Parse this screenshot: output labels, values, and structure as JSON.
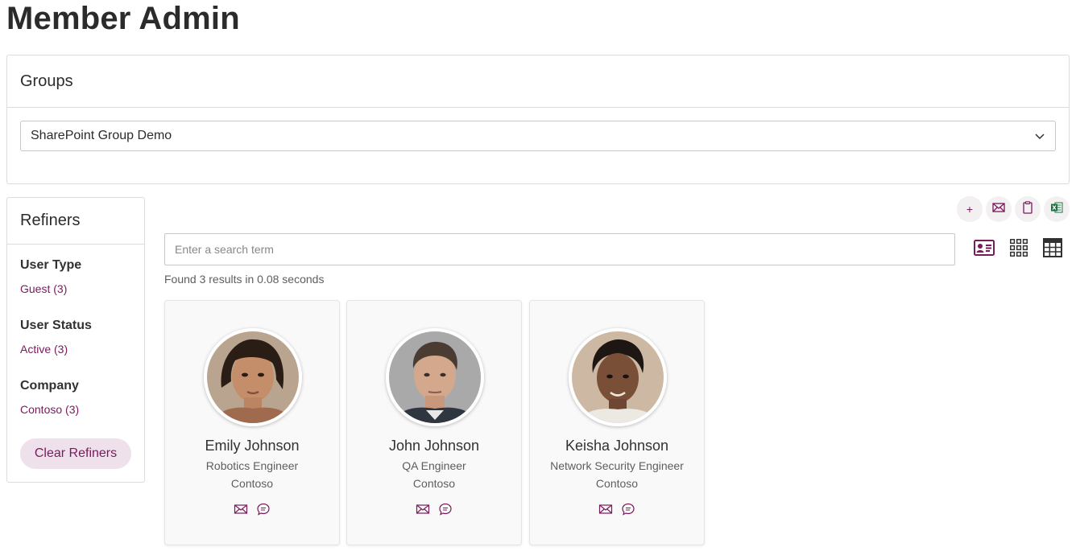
{
  "page": {
    "title": "Member Admin"
  },
  "groups": {
    "title": "Groups",
    "selected": "SharePoint Group Demo"
  },
  "refiners": {
    "title": "Refiners",
    "groups": [
      {
        "heading": "User Type",
        "option": "Guest (3)"
      },
      {
        "heading": "User Status",
        "option": "Active (3)"
      },
      {
        "heading": "Company",
        "option": "Contoso (3)"
      }
    ],
    "clear_label": "Clear Refiners"
  },
  "actions": [
    {
      "icon": "plus-icon",
      "label": "+"
    },
    {
      "icon": "mail-icon"
    },
    {
      "icon": "clipboard-icon"
    },
    {
      "icon": "excel-icon"
    }
  ],
  "search": {
    "placeholder": "Enter a search term",
    "results_text": "Found 3 results in 0.08 seconds"
  },
  "view_modes": [
    {
      "icon": "contact-card-icon"
    },
    {
      "icon": "grid-icon"
    },
    {
      "icon": "table-icon"
    }
  ],
  "members": [
    {
      "name": "Emily Johnson",
      "title": "Robotics Engineer",
      "company": "Contoso"
    },
    {
      "name": "John Johnson",
      "title": "QA Engineer",
      "company": "Contoso"
    },
    {
      "name": "Keisha Johnson",
      "title": "Network Security Engineer",
      "company": "Contoso"
    }
  ],
  "colors": {
    "accent": "#7a1a5c",
    "accent_light": "#efe1ec",
    "excel_green": "#1d6f42"
  }
}
